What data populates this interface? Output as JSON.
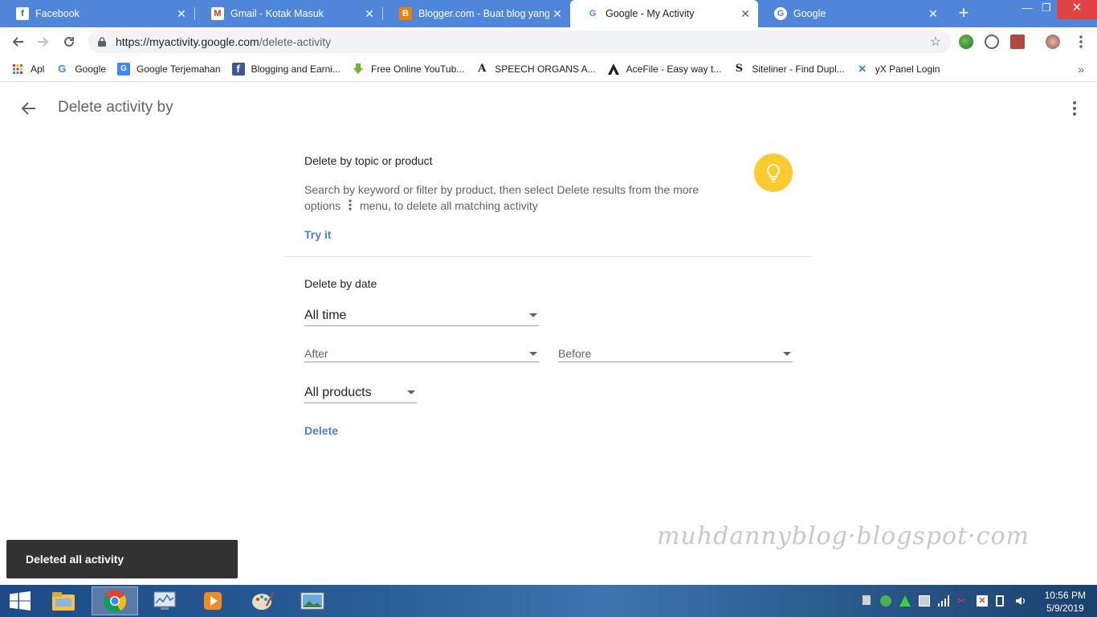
{
  "browser": {
    "tabs": [
      {
        "title": "Facebook",
        "favicon": "facebook-icon",
        "active": false
      },
      {
        "title": "Gmail - Kotak Masuk",
        "favicon": "gmail-icon",
        "active": false
      },
      {
        "title": "Blogger.com - Buat blog yang u",
        "favicon": "blogger-icon",
        "active": false
      },
      {
        "title": "Google - My Activity",
        "favicon": "google-icon",
        "active": true
      },
      {
        "title": "Google",
        "favicon": "google-icon",
        "active": false
      }
    ],
    "url_host": "https://myactivity.google.com",
    "url_path": "/delete-activity",
    "bookmarks": [
      {
        "label": "Apl",
        "icon": "apps-grid-icon"
      },
      {
        "label": "Google",
        "icon": "google-icon"
      },
      {
        "label": "Google Terjemahan",
        "icon": "translate-icon"
      },
      {
        "label": "Blogging and Earni...",
        "icon": "facebook-icon"
      },
      {
        "label": "Free Online YouTub...",
        "icon": "download-arrow-icon"
      },
      {
        "label": "SPEECH ORGANS A...",
        "icon": "letter-a-icon"
      },
      {
        "label": "AceFile - Easy way t...",
        "icon": "acefile-icon"
      },
      {
        "label": "Siteliner - Find Dupl...",
        "icon": "siteliner-icon"
      },
      {
        "label": "yX Panel Login",
        "icon": "yx-icon"
      }
    ]
  },
  "page": {
    "title": "Delete activity by",
    "topic_section": {
      "heading": "Delete by topic or product",
      "description_part1": "Search by keyword or filter by product, then select Delete results from the more options",
      "description_part2": "menu, to delete all matching activity",
      "link": "Try it"
    },
    "date_section": {
      "heading": "Delete by date",
      "range_value": "All time",
      "after_label": "After",
      "before_label": "Before",
      "products_value": "All products",
      "delete_label": "Delete"
    },
    "snackbar": "Deleted all activity",
    "watermark": "muhdannyblog·blogspot·com"
  },
  "taskbar": {
    "time": "10:56 PM",
    "date": "5/9/2019"
  },
  "colors": {
    "tabstrip": "#4f86d9",
    "link": "#4a7fd6",
    "bulb": "#fbcb2f",
    "snackbar": "#323232"
  }
}
